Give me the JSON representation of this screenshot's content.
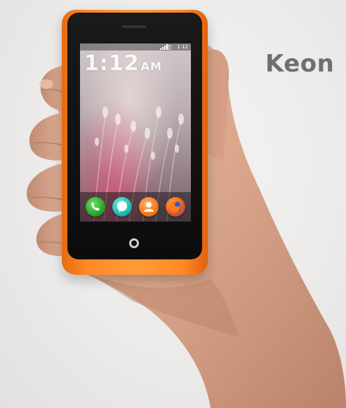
{
  "brand": {
    "label": "Keon"
  },
  "phone": {
    "color": "#ff8a26",
    "lock_screen": {
      "time": "1:12",
      "ampm": "AM",
      "date": "",
      "status_time": "1:12"
    },
    "dock_apps": [
      {
        "name": "phone-icon"
      },
      {
        "name": "messages-icon"
      },
      {
        "name": "contacts-icon"
      },
      {
        "name": "browser-icon"
      }
    ]
  },
  "colors": {
    "background": "#ecebea",
    "brand_text": "#6f6f6f",
    "phone_orange": "#ff8a26",
    "skin": "#d9a58a"
  }
}
